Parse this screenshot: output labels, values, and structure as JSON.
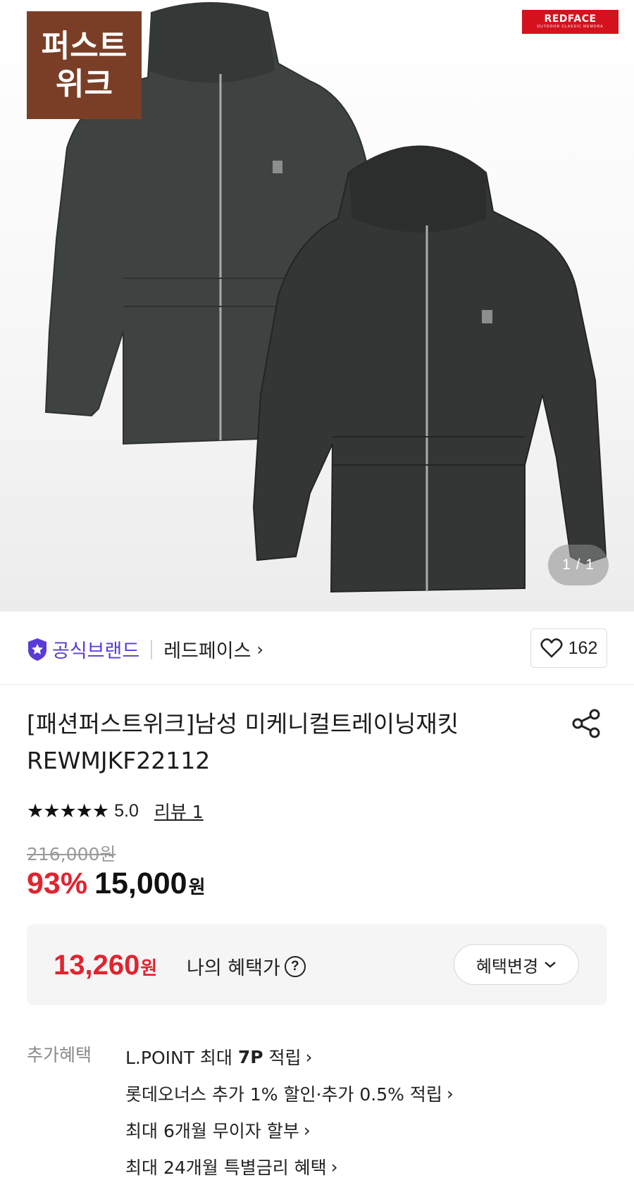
{
  "hero": {
    "promo_badge": "퍼스트\n위크",
    "brand_logo_name": "REDFACE",
    "brand_logo_sub": "OUTDOOR CLASSIC MEMORA",
    "page_indicator": "1 / 1",
    "jacket_color": "#3a3d3c"
  },
  "brand": {
    "official_label": "공식브랜드",
    "brand_name": "레드페이스",
    "brand_chevron": "›",
    "like_count": "162"
  },
  "product": {
    "title": "[패션퍼스트위크]남성 미케니컬트레이닝재킷 REWMJKF22112",
    "rating": "5.0",
    "review_label": "리뷰 1",
    "stars": [
      "★",
      "★",
      "★",
      "★",
      "★"
    ],
    "original_price": "216,000원",
    "discount": "93%",
    "sale_price": "15,000",
    "sale_unit": "원"
  },
  "benefit": {
    "amount": "13,260",
    "unit": "원",
    "label": "나의 혜택가",
    "help": "?",
    "change_button": "혜택변경",
    "change_chevron": "⌄"
  },
  "extra": {
    "label": "추가혜택",
    "items": [
      {
        "prefix": "L.POINT 최대 ",
        "bold": "7P",
        "suffix": " 적립"
      },
      {
        "prefix": "롯데오너스 추가 1% 할인·추가 0.5% 적립",
        "bold": "",
        "suffix": ""
      },
      {
        "prefix": "최대 6개월 무이자 할부",
        "bold": "",
        "suffix": ""
      },
      {
        "prefix": "최대 24개월 특별금리 혜택",
        "bold": "",
        "suffix": ""
      }
    ],
    "chevron": "›"
  },
  "colors": {
    "accent_red": "#e0242f",
    "official_purple": "#5a3bd8",
    "promo_brown": "#7a3e26",
    "brand_red": "#d4121e"
  }
}
